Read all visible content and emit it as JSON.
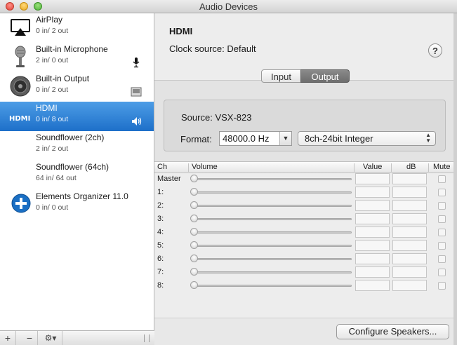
{
  "window": {
    "title": "Audio Devices"
  },
  "devices": [
    {
      "name": "AirPlay",
      "io": "0 in/ 2 out",
      "icon": "airplay-icon",
      "right_icon": ""
    },
    {
      "name": "Built-in Microphone",
      "io": "2 in/ 0 out",
      "icon": "microphone-icon",
      "right_icon": "mic-input-icon"
    },
    {
      "name": "Built-in Output",
      "io": "0 in/ 2 out",
      "icon": "speaker-icon",
      "right_icon": "finder-icon"
    },
    {
      "name": "HDMI",
      "io": "0 in/ 8 out",
      "icon": "hdmi-icon",
      "right_icon": "speaker-output-icon"
    },
    {
      "name": "Soundflower (2ch)",
      "io": "2 in/ 2 out",
      "icon": "",
      "right_icon": ""
    },
    {
      "name": "Soundflower (64ch)",
      "io": "64 in/ 64 out",
      "icon": "",
      "right_icon": ""
    },
    {
      "name": "Elements Organizer 11.0",
      "io": "0 in/ 0 out",
      "icon": "plus-circle-icon",
      "right_icon": ""
    }
  ],
  "selected_device": "HDMI",
  "bottombar": {
    "add": "+",
    "remove": "−",
    "gear": "⚙▾"
  },
  "detail": {
    "title": "HDMI",
    "clock_source_label": "Clock source:",
    "clock_source_value": "Default",
    "help": "?",
    "tabs": [
      "Input",
      "Output"
    ],
    "active_tab": "Output",
    "source_label": "Source:",
    "source_value": "VSX-823",
    "format_label": "Format:",
    "sample_rate": "48000.0 Hz",
    "bit_format": "8ch-24bit Integer",
    "configure_button": "Configure Speakers..."
  },
  "table": {
    "headers": {
      "ch": "Ch",
      "volume": "Volume",
      "value": "Value",
      "db": "dB",
      "mute": "Mute"
    },
    "rows": [
      {
        "ch": "Master"
      },
      {
        "ch": "1:"
      },
      {
        "ch": "2:"
      },
      {
        "ch": "3:"
      },
      {
        "ch": "4:"
      },
      {
        "ch": "5:"
      },
      {
        "ch": "6:"
      },
      {
        "ch": "7:"
      },
      {
        "ch": "8:"
      }
    ]
  },
  "colors": {
    "selection": "#1d6fc9",
    "segment_active": "#6d6d6d"
  }
}
